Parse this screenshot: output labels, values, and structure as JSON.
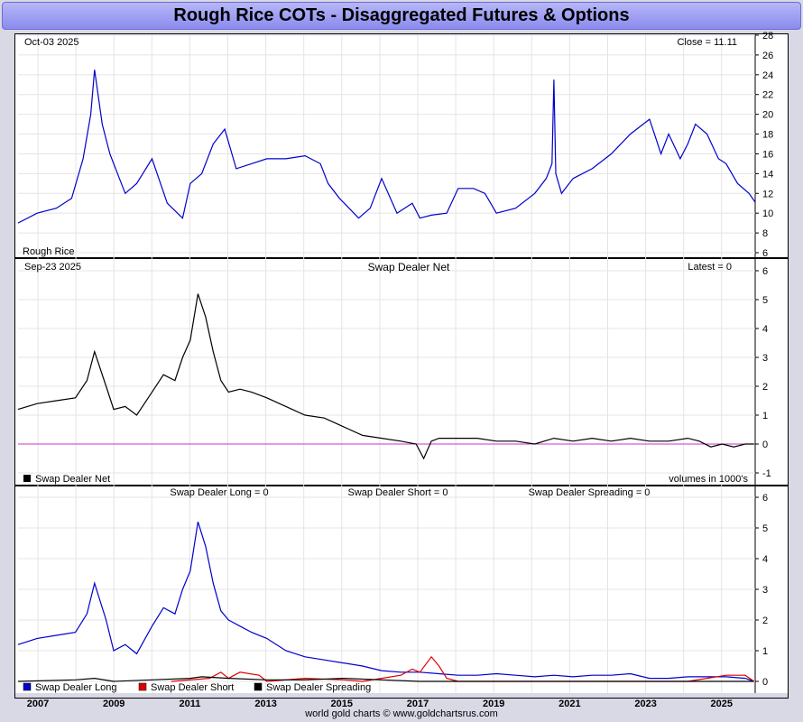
{
  "title": "Rough Rice COTs - Disaggregated Futures & Options",
  "credit": "world gold charts © www.goldchartsrus.com",
  "x_ticks": [
    "2007",
    "2009",
    "2011",
    "2013",
    "2015",
    "2017",
    "2019",
    "2021",
    "2023",
    "2025"
  ],
  "chart_data": [
    {
      "type": "line",
      "panel": "price",
      "date_label": "Oct-03  2025",
      "readout": "Close = 11.11",
      "legend": "Rough Rice",
      "ylim": [
        6,
        28
      ],
      "yticks": [
        "6",
        "8",
        "10",
        "12",
        "14",
        "16",
        "18",
        "20",
        "22",
        "24",
        "26",
        "28"
      ],
      "color": "#0000cc",
      "series": [
        {
          "name": "Rough Rice",
          "x": [
            2006.5,
            2007.0,
            2007.5,
            2007.9,
            2008.2,
            2008.4,
            2008.5,
            2008.7,
            2008.9,
            2009.0,
            2009.3,
            2009.6,
            2010.0,
            2010.4,
            2010.8,
            2011.0,
            2011.3,
            2011.6,
            2011.9,
            2012.2,
            2012.6,
            2013.0,
            2013.5,
            2014.0,
            2014.4,
            2014.6,
            2014.9,
            2015.4,
            2015.7,
            2016.0,
            2016.4,
            2016.8,
            2017.0,
            2017.3,
            2017.7,
            2018.0,
            2018.4,
            2018.7,
            2019.0,
            2019.5,
            2020.0,
            2020.3,
            2020.45,
            2020.5,
            2020.55,
            2020.7,
            2021.0,
            2021.5,
            2022.0,
            2022.5,
            2023.0,
            2023.3,
            2023.5,
            2023.8,
            2024.0,
            2024.2,
            2024.5,
            2024.8,
            2025.0,
            2025.3,
            2025.6,
            2025.76
          ],
          "y": [
            9,
            10,
            10.5,
            11.5,
            15.5,
            20,
            24.5,
            19,
            16,
            15,
            12,
            13,
            15.5,
            11,
            9.5,
            13,
            14,
            17,
            18.5,
            14.5,
            15,
            15.5,
            15.5,
            15.8,
            15,
            13,
            11.5,
            9.5,
            10.5,
            13.5,
            10,
            11,
            9.5,
            9.8,
            10,
            12.5,
            12.5,
            12,
            10,
            10.5,
            12,
            13.5,
            15,
            23.5,
            14,
            12,
            13.5,
            14.5,
            16,
            18,
            19.5,
            16,
            18,
            15.5,
            17,
            19,
            18,
            15.5,
            15,
            13,
            12,
            11.11
          ]
        }
      ]
    },
    {
      "type": "line",
      "panel": "swap-dealer-net",
      "date_label": "Sep-23  2025",
      "title": "Swap Dealer Net",
      "readout": "Latest = 0",
      "legend": "Swap Dealer Net",
      "units_note": "volumes in 1000's",
      "ylim": [
        -1,
        6
      ],
      "yticks": [
        "-1",
        "0",
        "1",
        "2",
        "3",
        "4",
        "5",
        "6"
      ],
      "zero_line_color": "#cc33cc",
      "color": "#000000",
      "series": [
        {
          "name": "Swap Dealer Net",
          "x": [
            2006.5,
            2007.0,
            2007.5,
            2008.0,
            2008.3,
            2008.5,
            2008.8,
            2009.0,
            2009.3,
            2009.6,
            2010.0,
            2010.3,
            2010.6,
            2010.8,
            2011.0,
            2011.2,
            2011.4,
            2011.6,
            2011.8,
            2012.0,
            2012.3,
            2012.6,
            2013.0,
            2013.5,
            2014.0,
            2014.5,
            2015.0,
            2015.5,
            2016.0,
            2016.5,
            2016.9,
            2017.1,
            2017.3,
            2017.5,
            2018.0,
            2018.5,
            2019.0,
            2019.5,
            2020.0,
            2020.5,
            2021.0,
            2021.5,
            2022.0,
            2022.5,
            2023.0,
            2023.5,
            2024.0,
            2024.3,
            2024.6,
            2024.9,
            2025.2,
            2025.5,
            2025.73
          ],
          "y": [
            1.2,
            1.4,
            1.5,
            1.6,
            2.2,
            3.2,
            2.0,
            1.2,
            1.3,
            1.0,
            1.8,
            2.4,
            2.2,
            3.0,
            3.6,
            5.2,
            4.4,
            3.2,
            2.2,
            1.8,
            1.9,
            1.8,
            1.6,
            1.3,
            1.0,
            0.9,
            0.6,
            0.3,
            0.2,
            0.1,
            0.0,
            -0.5,
            0.1,
            0.2,
            0.2,
            0.2,
            0.1,
            0.1,
            0.0,
            0.2,
            0.1,
            0.2,
            0.1,
            0.2,
            0.1,
            0.1,
            0.2,
            0.1,
            -0.1,
            0.0,
            -0.1,
            0.0,
            0.0
          ]
        }
      ]
    },
    {
      "type": "line",
      "panel": "swap-dealer-components",
      "readouts": [
        "Swap Dealer Long = 0",
        "Swap Dealer Short = 0",
        "Swap Dealer Spreading = 0"
      ],
      "ylim": [
        0,
        6
      ],
      "yticks": [
        "0",
        "1",
        "2",
        "3",
        "4",
        "5",
        "6"
      ],
      "series": [
        {
          "name": "Swap Dealer Long",
          "color": "#0000cc",
          "x": [
            2006.5,
            2007.0,
            2007.5,
            2008.0,
            2008.3,
            2008.5,
            2008.8,
            2009.0,
            2009.3,
            2009.6,
            2010.0,
            2010.3,
            2010.6,
            2010.8,
            2011.0,
            2011.2,
            2011.4,
            2011.6,
            2011.8,
            2012.0,
            2012.3,
            2012.6,
            2013.0,
            2013.5,
            2014.0,
            2014.5,
            2015.0,
            2015.5,
            2016.0,
            2016.5,
            2017.0,
            2017.5,
            2018.0,
            2018.5,
            2019.0,
            2019.5,
            2020.0,
            2020.5,
            2021.0,
            2021.5,
            2022.0,
            2022.5,
            2023.0,
            2023.5,
            2024.0,
            2024.5,
            2025.0,
            2025.5,
            2025.73
          ],
          "y": [
            1.2,
            1.4,
            1.5,
            1.6,
            2.2,
            3.2,
            2.0,
            1.0,
            1.2,
            0.9,
            1.8,
            2.4,
            2.2,
            3.0,
            3.6,
            5.2,
            4.4,
            3.2,
            2.3,
            2.0,
            1.8,
            1.6,
            1.4,
            1.0,
            0.8,
            0.7,
            0.6,
            0.5,
            0.35,
            0.3,
            0.3,
            0.25,
            0.2,
            0.2,
            0.25,
            0.2,
            0.15,
            0.2,
            0.15,
            0.2,
            0.2,
            0.25,
            0.1,
            0.1,
            0.15,
            0.15,
            0.15,
            0.1,
            0.0
          ]
        },
        {
          "name": "Swap Dealer Short",
          "color": "#dd0000",
          "x": [
            2010.5,
            2011.5,
            2011.8,
            2012.0,
            2012.3,
            2012.8,
            2013.0,
            2014.0,
            2015.0,
            2015.5,
            2016.0,
            2016.5,
            2016.8,
            2017.0,
            2017.3,
            2017.5,
            2017.7,
            2018.0,
            2019.0,
            2020.0,
            2021.0,
            2022.0,
            2023.0,
            2024.0,
            2024.5,
            2025.0,
            2025.5,
            2025.73
          ],
          "y": [
            0,
            0.1,
            0.3,
            0.1,
            0.3,
            0.2,
            0.0,
            0.1,
            0.05,
            0.0,
            0.1,
            0.2,
            0.4,
            0.3,
            0.8,
            0.5,
            0.1,
            0.0,
            0.0,
            0.0,
            0.0,
            0.0,
            0.0,
            0.0,
            0.1,
            0.2,
            0.2,
            0.0
          ]
        },
        {
          "name": "Swap Dealer Spreading",
          "color": "#000000",
          "x": [
            2006.5,
            2008.0,
            2008.5,
            2009.0,
            2010.0,
            2011.0,
            2011.3,
            2012.0,
            2013.0,
            2014.0,
            2015.0,
            2016.0,
            2017.0,
            2018.0,
            2020.0,
            2022.0,
            2024.0,
            2025.73
          ],
          "y": [
            0,
            0.05,
            0.1,
            0.0,
            0.05,
            0.1,
            0.15,
            0.1,
            0.05,
            0.05,
            0.1,
            0.05,
            0.0,
            0.0,
            0.0,
            0.0,
            0.0,
            0.0
          ]
        }
      ]
    }
  ]
}
